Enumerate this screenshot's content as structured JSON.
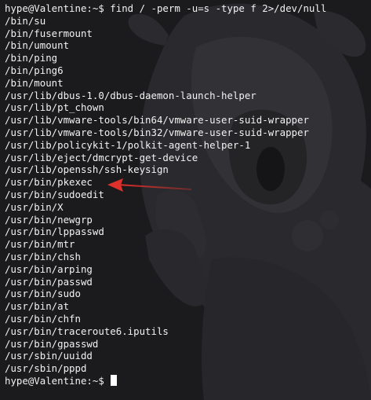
{
  "terminal": {
    "prompt": "hype@Valentine:~$",
    "command": "find / -perm -u=s -type f 2>/dev/null",
    "output": [
      "/bin/su",
      "/bin/fusermount",
      "/bin/umount",
      "/bin/ping",
      "/bin/ping6",
      "/bin/mount",
      "/usr/lib/dbus-1.0/dbus-daemon-launch-helper",
      "/usr/lib/pt_chown",
      "/usr/lib/vmware-tools/bin64/vmware-user-suid-wrapper",
      "/usr/lib/vmware-tools/bin32/vmware-user-suid-wrapper",
      "/usr/lib/policykit-1/polkit-agent-helper-1",
      "/usr/lib/eject/dmcrypt-get-device",
      "/usr/lib/openssh/ssh-keysign",
      "/usr/bin/pkexec",
      "/usr/bin/sudoedit",
      "/usr/bin/X",
      "/usr/bin/newgrp",
      "/usr/bin/lppasswd",
      "/usr/bin/mtr",
      "/usr/bin/chsh",
      "/usr/bin/arping",
      "/usr/bin/passwd",
      "/usr/bin/sudo",
      "/usr/bin/at",
      "/usr/bin/chfn",
      "/usr/bin/traceroute6.iputils",
      "/usr/bin/gpasswd",
      "/usr/sbin/uuidd",
      "/usr/sbin/pppd"
    ],
    "final_prompt": "hype@Valentine:~$"
  },
  "annotation": {
    "arrow_color": "#e0302b",
    "points_to": "/usr/bin/pkexec"
  },
  "colors": {
    "background": "#1b1b1e",
    "text": "#f2f2f2"
  }
}
